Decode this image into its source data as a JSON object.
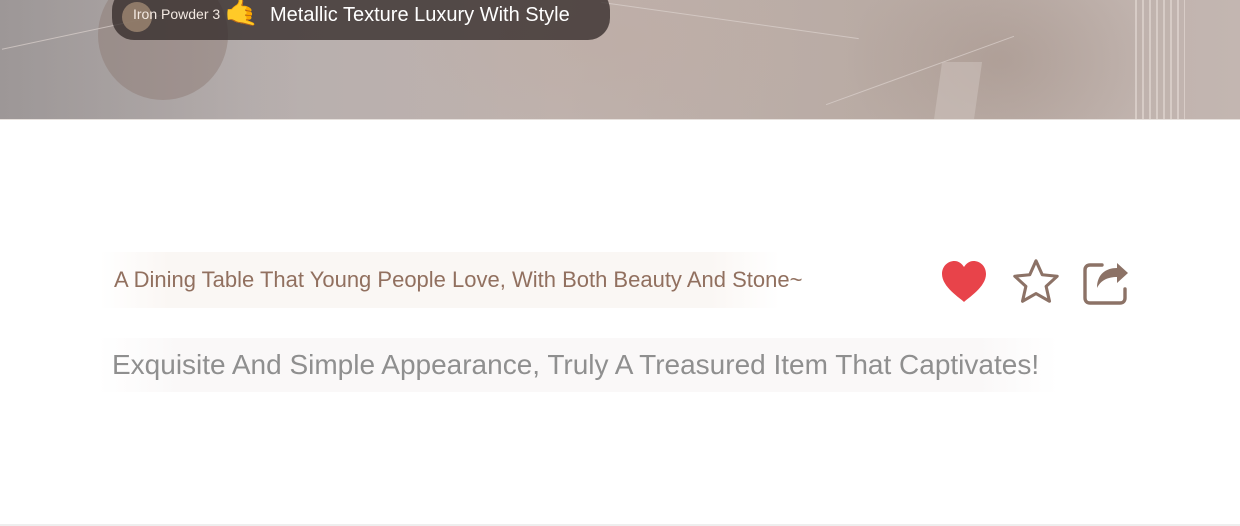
{
  "hero": {
    "tag": {
      "label": "Iron Powder 3",
      "emoji": "🤙",
      "text": "Metallic Texture Luxury With Style"
    }
  },
  "content": {
    "headline": "A Dining Table That Young People Love, With Both Beauty And Stone~",
    "subline": "Exquisite And Simple Appearance, Truly A Treasured Item That Captivates!"
  },
  "actions": {
    "like_icon": "heart-icon",
    "favorite_icon": "star-icon",
    "share_icon": "share-icon",
    "colors": {
      "heart": "#e8434a",
      "outline": "#8c7266"
    }
  }
}
